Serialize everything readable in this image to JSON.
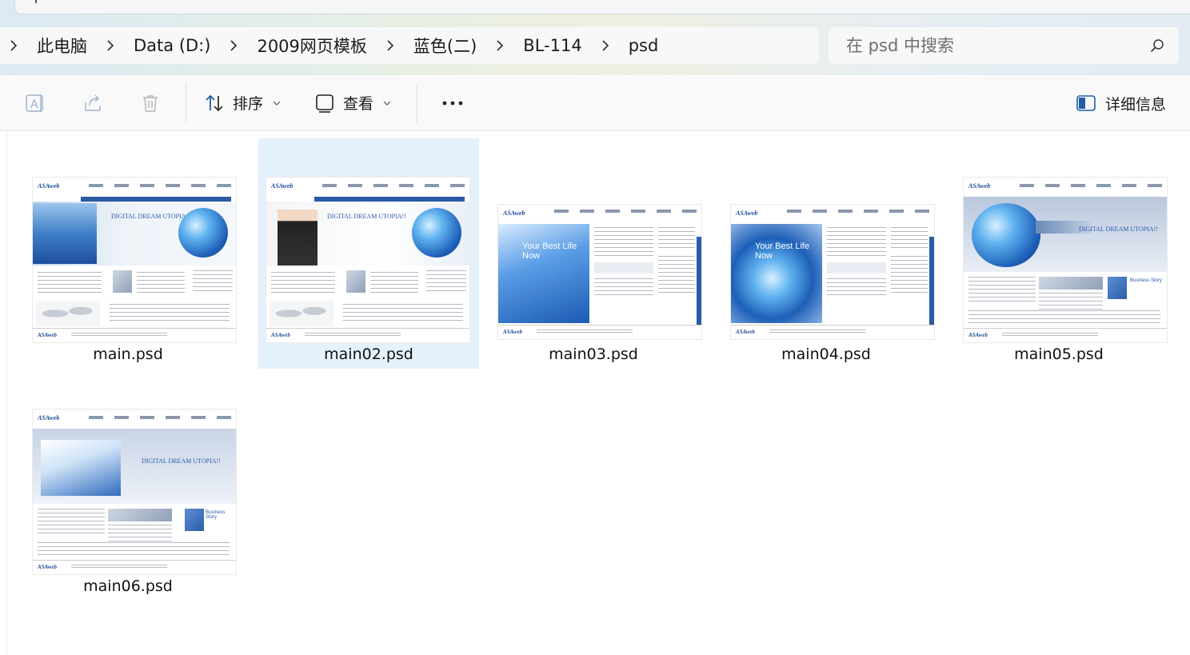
{
  "address_bar": {
    "breadcrumbs": [
      "此电脑",
      "Data (D:)",
      "2009网页模板",
      "蓝色(二)",
      "BL-114",
      "psd"
    ]
  },
  "search": {
    "placeholder": "在 psd 中搜索"
  },
  "command_bar": {
    "sort_label": "排序",
    "view_label": "查看",
    "more_label": "•••",
    "details_label": "详细信息"
  },
  "files": [
    {
      "name": "main.psd",
      "selected": false
    },
    {
      "name": "main02.psd",
      "selected": true
    },
    {
      "name": "main03.psd",
      "selected": false
    },
    {
      "name": "main04.psd",
      "selected": false
    },
    {
      "name": "main05.psd",
      "selected": false
    },
    {
      "name": "main06.psd",
      "selected": false
    }
  ],
  "thumbnails": {
    "logo": "ASAweb",
    "tagline": "DIGITAL DREAM UTOPIA!!",
    "hero_text": "Your Best Life Now",
    "business_text": "Business Story"
  },
  "colors": {
    "accent": "#2b58a3",
    "selection": "#e5f1fb",
    "command_bar_bg": "#f9f9f9"
  }
}
